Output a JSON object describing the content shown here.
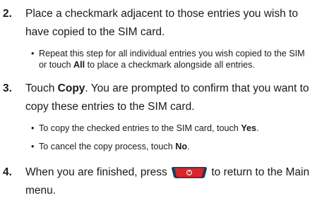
{
  "steps": [
    {
      "number": "2.",
      "line1": "Place a checkmark adjacent to those entries you wish to",
      "line2": "have copied to the SIM card.",
      "bullets": [
        {
          "line1": "Repeat this step for all individual entries you wish copied to the SIM",
          "line2_prefix": "or touch ",
          "line2_bold": "All",
          "line2_suffix": " to place a checkmark alongside all entries."
        }
      ]
    },
    {
      "number": "3.",
      "line1_prefix": "Touch ",
      "line1_bold": "Copy",
      "line1_suffix": ". You are prompted to confirm that you want to",
      "line2": "copy these entries to the SIM card.",
      "bullets": [
        {
          "prefix": "To copy the checked entries to the SIM card, touch ",
          "bold": "Yes",
          "suffix": "."
        },
        {
          "prefix": "To cancel the copy process, touch ",
          "bold": "No",
          "suffix": "."
        }
      ]
    },
    {
      "number": "4.",
      "line1_prefix": "When you are finished, press",
      "line1_suffix": "to return to the Main",
      "line2": "menu.",
      "key_icon": "end-call-key-icon"
    }
  ],
  "bullet_glyph": "•",
  "colors": {
    "key_red": "#d8262b",
    "key_dark": "#1c3b5e",
    "text": "#1a1a1a"
  }
}
